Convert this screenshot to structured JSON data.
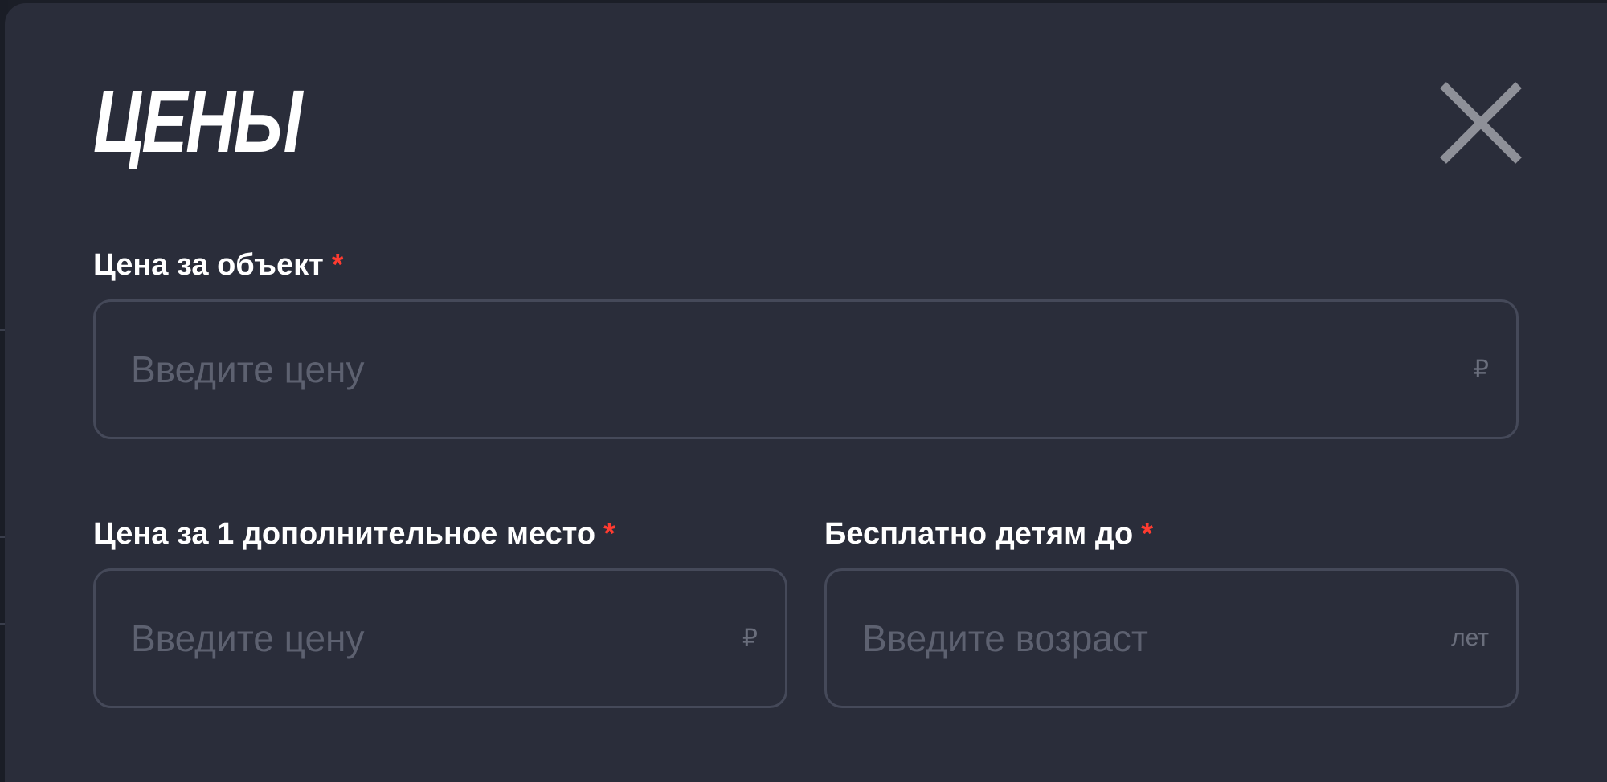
{
  "dialog": {
    "title": "ЦЕНЫ",
    "close_icon": "close-icon"
  },
  "fields": {
    "price_per_object": {
      "label": "Цена за объект",
      "required_mark": "*",
      "placeholder": "Введите цену",
      "value": "",
      "suffix": "₽"
    },
    "extra_place_price": {
      "label": "Цена за 1 дополнительное место",
      "required_mark": "*",
      "placeholder": "Введите цену",
      "value": "",
      "suffix": "₽"
    },
    "free_for_children_until": {
      "label": "Бесплатно детям до",
      "required_mark": "*",
      "placeholder": "Введите возраст",
      "value": "",
      "suffix": "лет"
    }
  },
  "colors": {
    "modal_background": "#2a2d3a",
    "text_primary": "#ffffff",
    "required_accent": "#ff3b30",
    "input_border": "#454959",
    "placeholder": "#5d6170"
  }
}
